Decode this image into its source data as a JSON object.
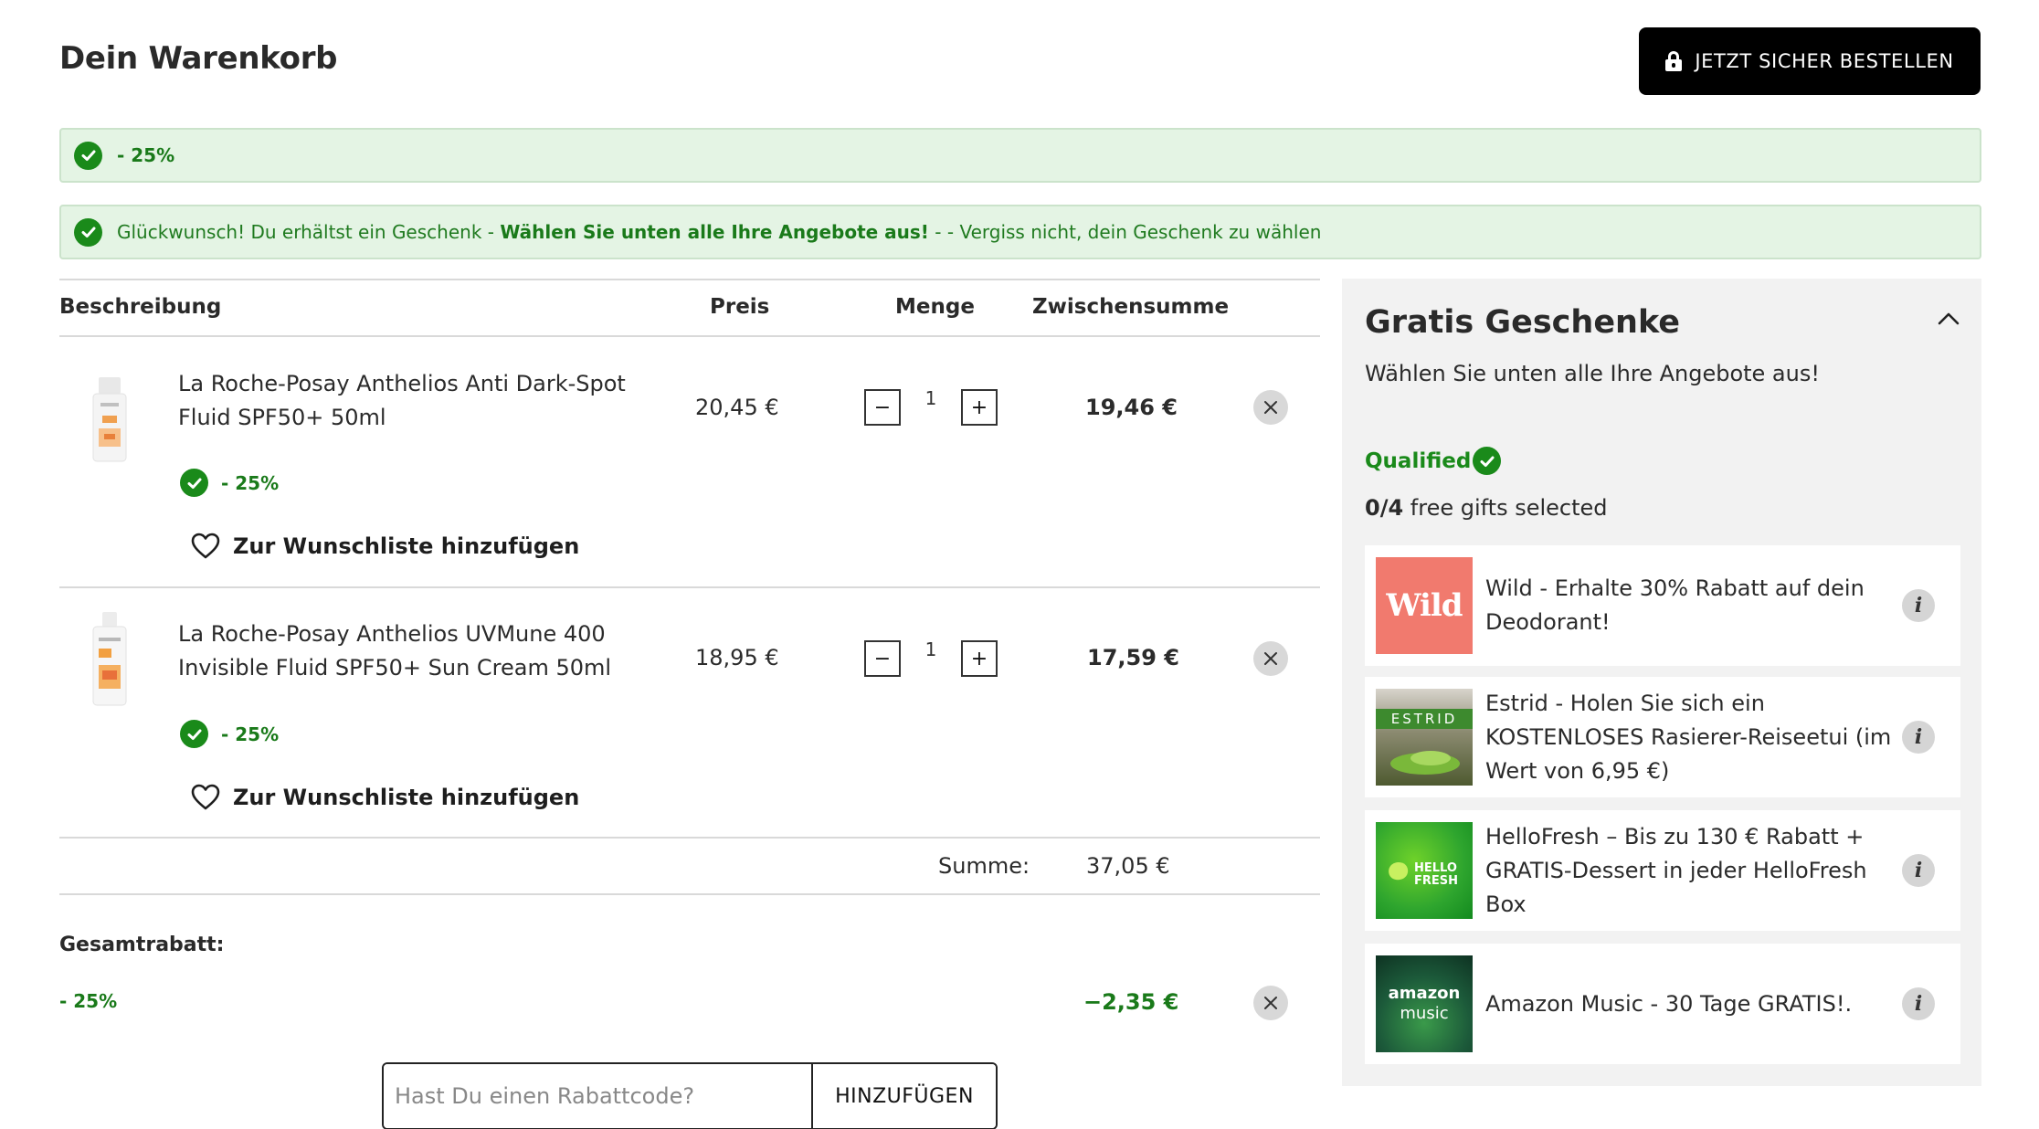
{
  "header": {
    "title": "Dein Warenkorb",
    "order_button": "JETZT SICHER BESTELLEN"
  },
  "banners": {
    "discount": "- 25%",
    "gift_prefix": "Glückwunsch! Du erhältst ein Geschenk - ",
    "gift_bold": "Wählen Sie unten alle Ihre Angebote aus!",
    "gift_suffix": " - - Vergiss nicht, dein Geschenk zu wählen"
  },
  "table": {
    "headers": {
      "description": "Beschreibung",
      "price": "Preis",
      "quantity": "Menge",
      "subtotal": "Zwischensumme"
    },
    "items": [
      {
        "name": "La Roche-Posay Anthelios Anti Dark-Spot Fluid SPF50+ 50ml",
        "price": "20,45 €",
        "quantity": "1",
        "subtotal": "19,46 €",
        "discount": "- 25%",
        "wishlist": "Zur Wunschliste hinzufügen"
      },
      {
        "name": "La Roche-Posay Anthelios UVMune 400 Invisible Fluid SPF50+ Sun Cream 50ml",
        "price": "18,95 €",
        "quantity": "1",
        "subtotal": "17,59 €",
        "discount": "- 25%",
        "wishlist": "Zur Wunschliste hinzufügen"
      }
    ],
    "sum_label": "Summe:",
    "sum_value": "37,05 €"
  },
  "total_discount": {
    "label": "Gesamtrabatt:",
    "name": "- 25%",
    "value": "−2,35 €"
  },
  "coupon": {
    "placeholder": "Hast Du einen Rabattcode?",
    "button": "HINZUFÜGEN"
  },
  "gifts": {
    "title": "Gratis Geschenke",
    "subtitle": "Wählen Sie unten alle Ihre Angebote aus!",
    "qualified": "Qualified",
    "count_selected": "0",
    "count_total": "4",
    "count_suffix": " free gifts selected",
    "offers": [
      {
        "text": "Wild - Erhalte 30% Rabatt auf dein Deodorant!",
        "logo_text": "Wild"
      },
      {
        "text": "Estrid - Holen Sie sich ein KOSTENLOSES Rasierer-Reiseetui (im Wert von 6,95 €)",
        "logo_text": "ESTRID"
      },
      {
        "text": "HelloFresh – Bis zu 130 € Rabatt + GRATIS-Dessert in jeder HelloFresh Box",
        "logo_text_1": "HELLO",
        "logo_text_2": "FRESH"
      },
      {
        "text": "Amazon Music - 30 Tage GRATIS!.",
        "logo_text_1": "amazon",
        "logo_text_2": "music"
      }
    ],
    "info_glyph": "i"
  },
  "colors": {
    "accent_green": "#1a8a1a",
    "banner_bg": "#e4f4e4",
    "button_black": "#000000"
  }
}
